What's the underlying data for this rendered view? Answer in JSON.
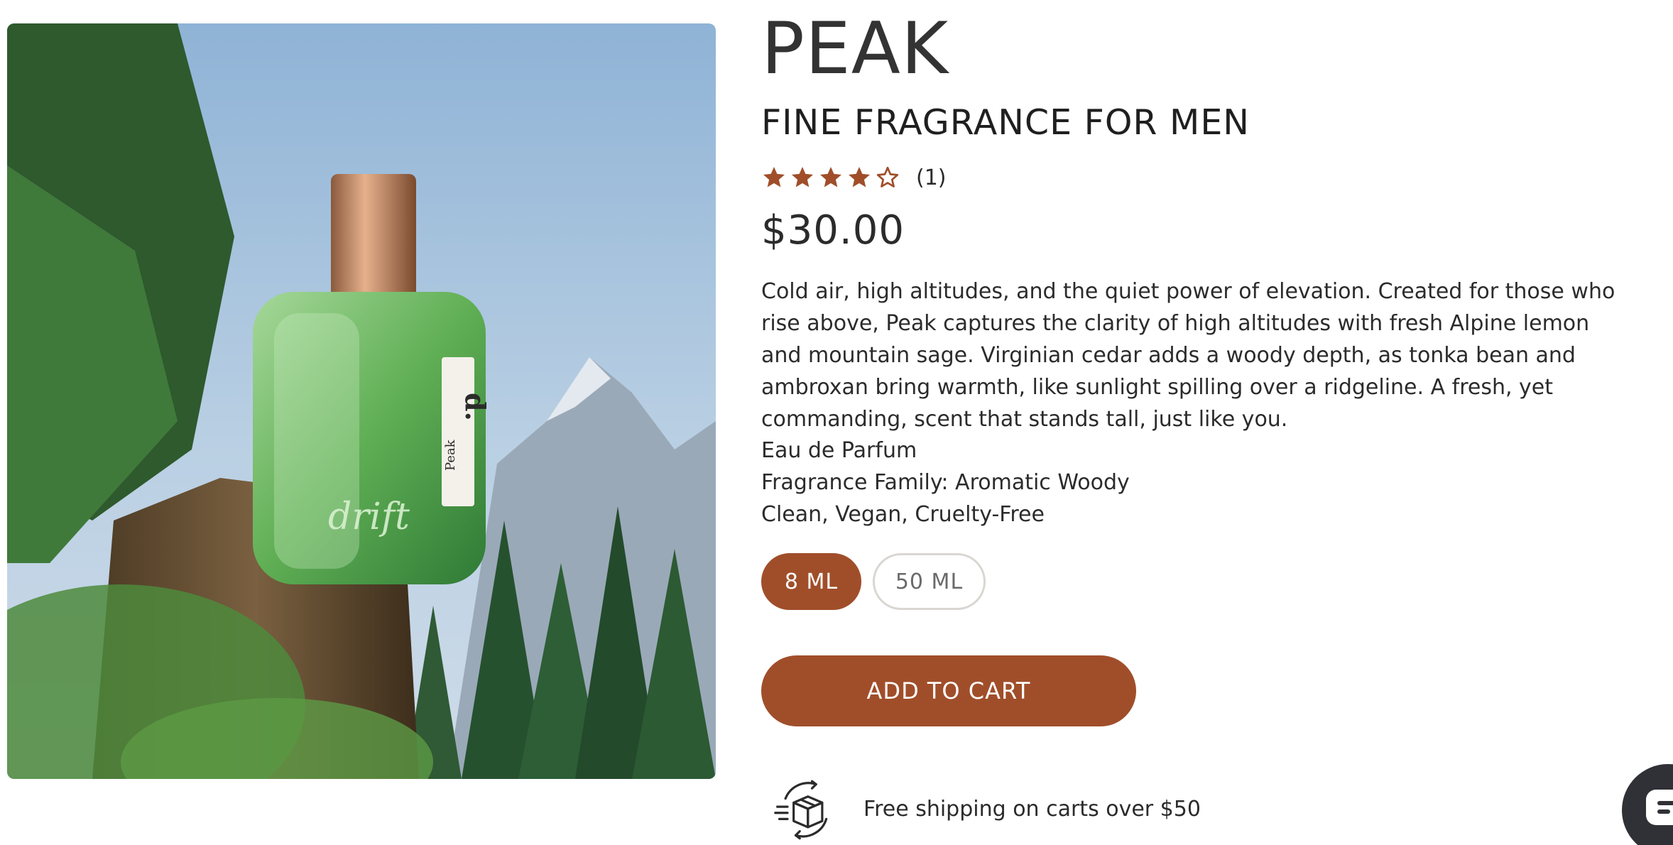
{
  "product": {
    "title": "PEAK",
    "subtitle": "FINE FRAGRANCE FOR MEN",
    "rating": {
      "value": 4,
      "max": 5,
      "count_label": "(1)"
    },
    "price": "$30.00",
    "description": "Cold air, high altitudes, and the quiet power of elevation. Created for those who rise above, Peak captures the clarity of high altitudes with fresh Alpine lemon and mountain sage. Virginian cedar adds a woody depth, as tonka bean and ambroxan bring warmth, like sunlight spilling over a ridgeline. A fresh, yet commanding, scent that stands tall, just like you.",
    "specs": [
      "Eau de Parfum",
      "Fragrance Family: Aromatic Woody",
      "Clean, Vegan, Cruelty-Free"
    ],
    "sizes": [
      {
        "label": "8 ML",
        "selected": true
      },
      {
        "label": "50 ML",
        "selected": false
      }
    ],
    "add_to_cart_label": "ADD TO CART",
    "shipping_note": "Free shipping on carts over $50",
    "image": {
      "alt": "Peak drift fragrance bottle on a mossy tree stump with mountains",
      "bottle_logo": "drift",
      "bottle_mark": "d.",
      "bottle_label": "Peak"
    }
  },
  "icons": {
    "star": "star-icon",
    "shipping": "shipping-box-icon",
    "chat": "chat-icon"
  },
  "colors": {
    "accent": "#a04e2a",
    "text": "#2b2b2b",
    "unselected_border": "#d9d6d2",
    "chat_widget": "#2f3136"
  }
}
